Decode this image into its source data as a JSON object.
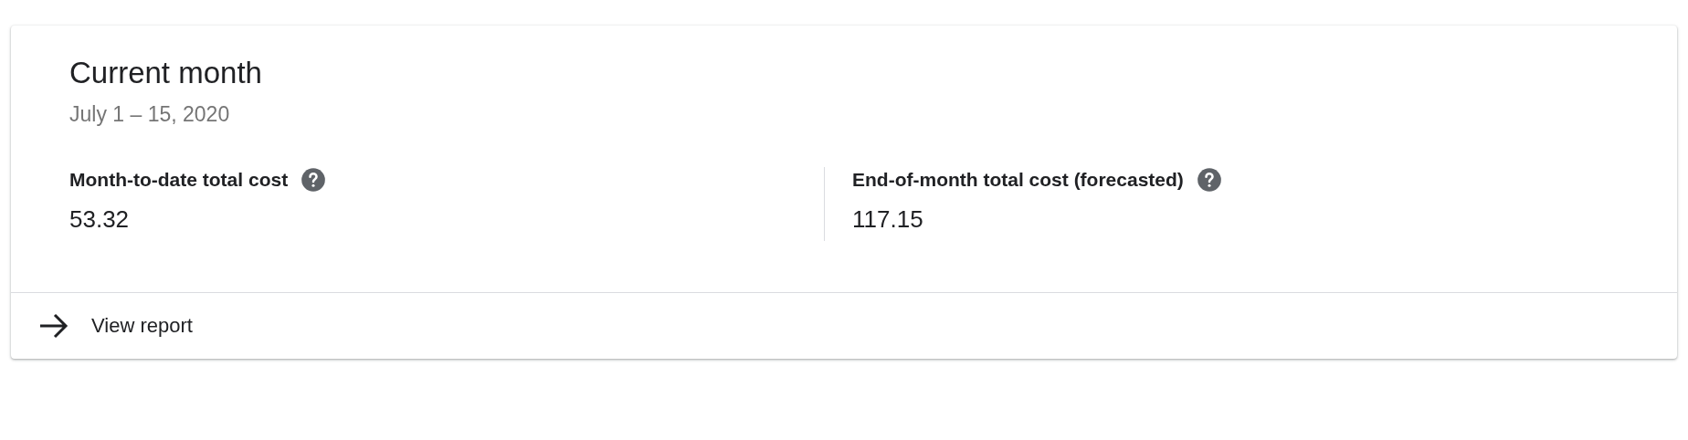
{
  "card": {
    "title": "Current month",
    "subtitle": "July 1 – 15, 2020",
    "metrics": [
      {
        "label": "Month-to-date total cost",
        "value": "53.32"
      },
      {
        "label": "End-of-month total cost (forecasted)",
        "value": "117.15"
      }
    ],
    "footer_link": "View report"
  }
}
